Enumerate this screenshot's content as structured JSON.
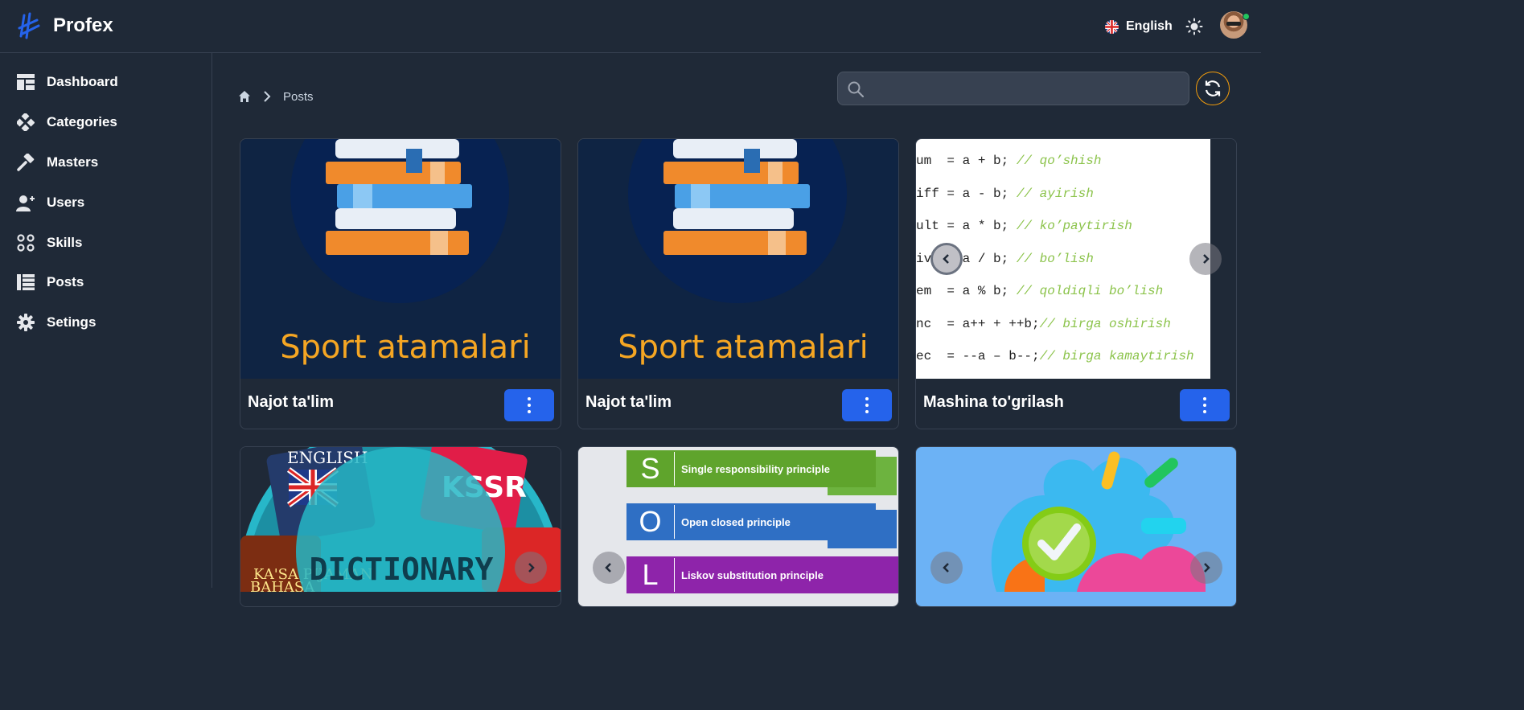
{
  "app": {
    "brand": "Profex"
  },
  "header": {
    "language": "English"
  },
  "sidebar": {
    "items": [
      {
        "label": "Dashboard",
        "icon": "dashboard-icon"
      },
      {
        "label": "Categories",
        "icon": "categories-icon"
      },
      {
        "label": "Masters",
        "icon": "hammer-icon"
      },
      {
        "label": "Users",
        "icon": "user-add-icon"
      },
      {
        "label": "Skills",
        "icon": "skills-icon"
      },
      {
        "label": "Posts",
        "icon": "list-icon"
      },
      {
        "label": "Setings",
        "icon": "gear-icon"
      }
    ]
  },
  "breadcrumb": {
    "current": "Posts"
  },
  "search": {
    "placeholder": ""
  },
  "posts": [
    {
      "title": "Najot ta'lim",
      "image_text": "Sport atamalari"
    },
    {
      "title": "Najot ta'lim",
      "image_text": "Sport atamalari"
    },
    {
      "title": "Mashina to'grilash",
      "code": [
        {
          "code": "um  = a + b; ",
          "comment": "// qo’shish"
        },
        {
          "code": "iff = a - b; ",
          "comment": "// ayirish"
        },
        {
          "code": "ult = a * b; ",
          "comment": "// ko’paytirish"
        },
        {
          "code": "iv    a / b; ",
          "comment": "// bo’lish"
        },
        {
          "code": "em  = a % b; ",
          "comment": "// qoldiqli bo’lish"
        },
        {
          "code": "nc  = a++ + ++b;",
          "comment": "// birga oshirish"
        },
        {
          "code": "ec  = --a – b--;",
          "comment": "// birga kamaytirish"
        }
      ]
    },
    {
      "title": "",
      "image_text": "DICTIONARY",
      "sub_texts": [
        "ENGLISH",
        "KSSR",
        "KA'SA PIJAMAN",
        "BAHASA"
      ]
    },
    {
      "title": "",
      "principles": [
        {
          "letter": "S",
          "text": "Single responsibility principle",
          "color": "#5fa42c"
        },
        {
          "letter": "O",
          "text": "Open closed principle",
          "color": "#2f6fc4"
        },
        {
          "letter": "L",
          "text": "Liskov substitution principle",
          "color": "#8e24aa"
        }
      ]
    },
    {
      "title": ""
    }
  ],
  "colors": {
    "accent": "#2563eb",
    "bg": "#1f2937",
    "refresh_border": "#f59e0b",
    "online": "#22c55e"
  }
}
